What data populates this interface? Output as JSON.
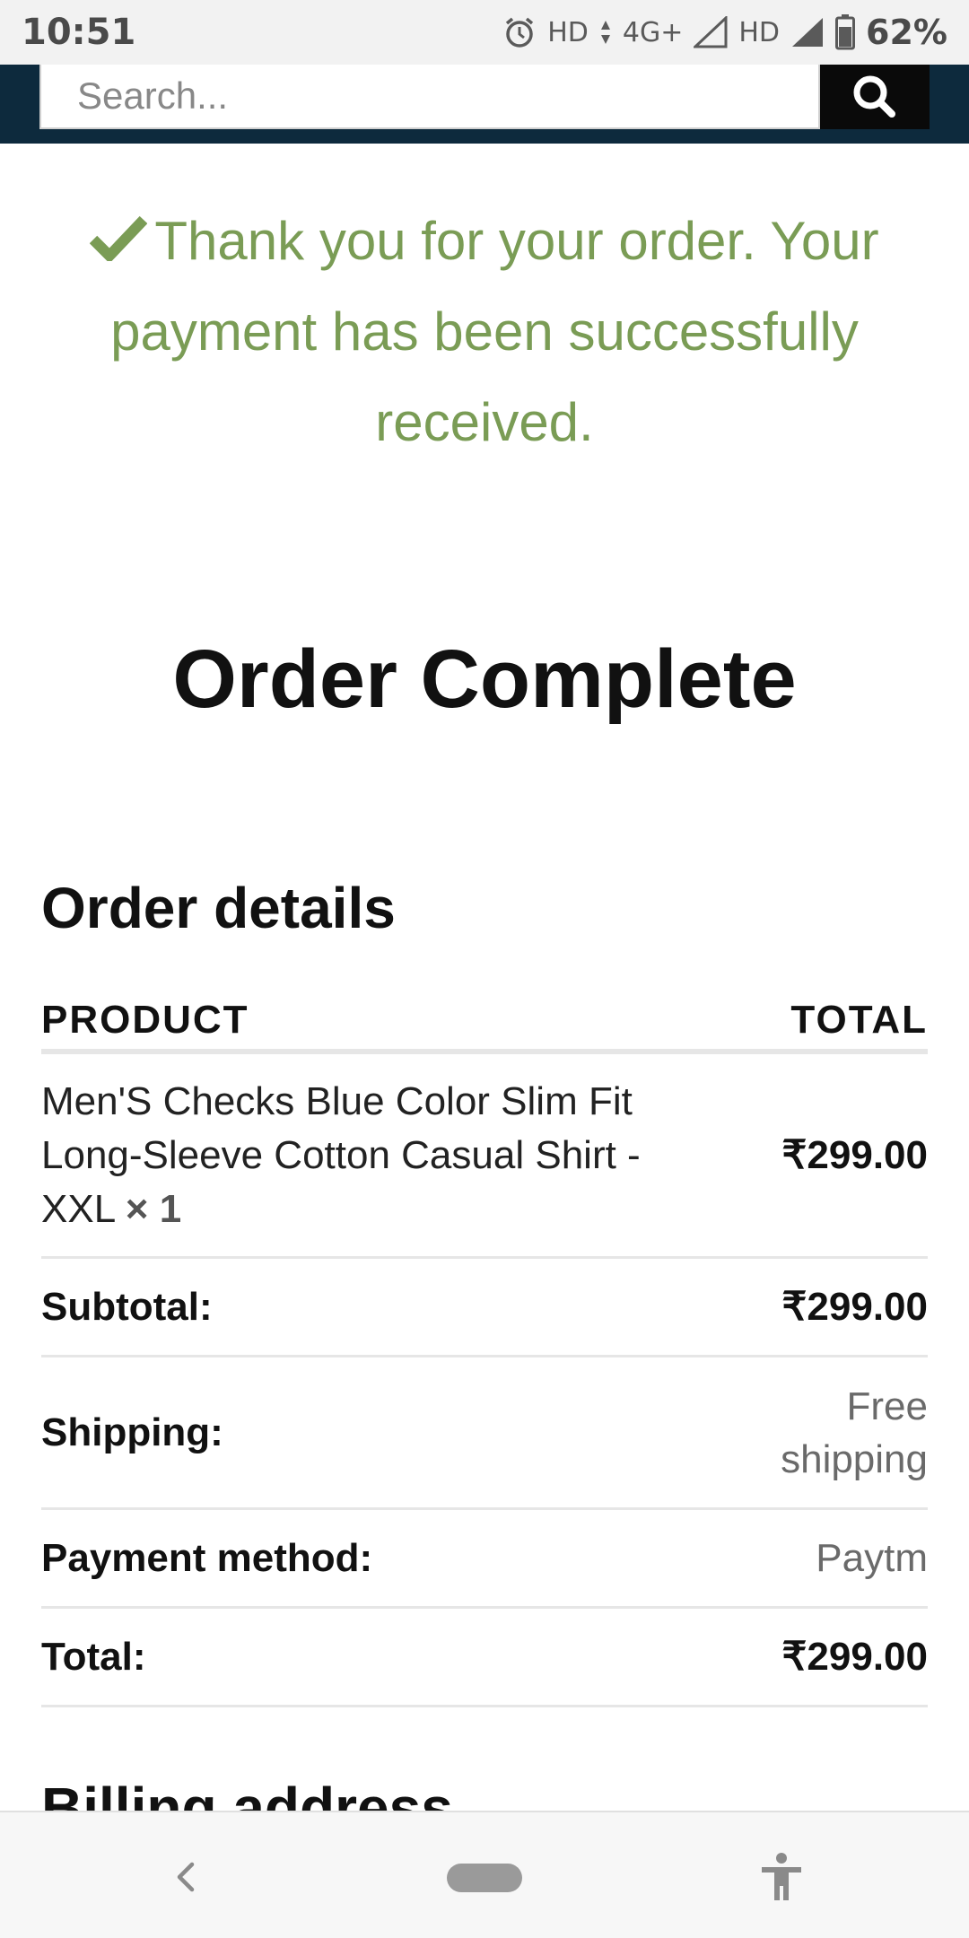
{
  "status_bar": {
    "time": "10:51",
    "hd1": "HD",
    "network": "4G+",
    "hd2": "HD",
    "battery": "62%"
  },
  "search": {
    "placeholder": "Search..."
  },
  "success_message": "Thank you for your order. Your payment has been successfully received.",
  "page_title": "Order Complete",
  "order_details": {
    "title": "Order details",
    "headers": {
      "product": "PRODUCT",
      "total": "TOTAL"
    },
    "product": {
      "name": "Men'S Checks Blue Color Slim Fit Long-Sleeve Cotton Casual Shirt - XXL",
      "qty": "× 1",
      "total": "₹299.00"
    },
    "rows": [
      {
        "label": "Subtotal:",
        "value": "₹299.00"
      },
      {
        "label": "Shipping:",
        "value": "Free shipping"
      },
      {
        "label": "Payment method:",
        "value": "Paytm"
      },
      {
        "label": "Total:",
        "value": "₹299.00"
      }
    ]
  },
  "billing_title": "Billing address",
  "colors": {
    "header_bg": "#0d2a3d",
    "success_green": "#7a9c55"
  },
  "icons": {
    "search": "search-icon",
    "check": "check-icon",
    "back": "back-icon",
    "home": "home-pill-icon",
    "accessibility": "accessibility-icon"
  }
}
